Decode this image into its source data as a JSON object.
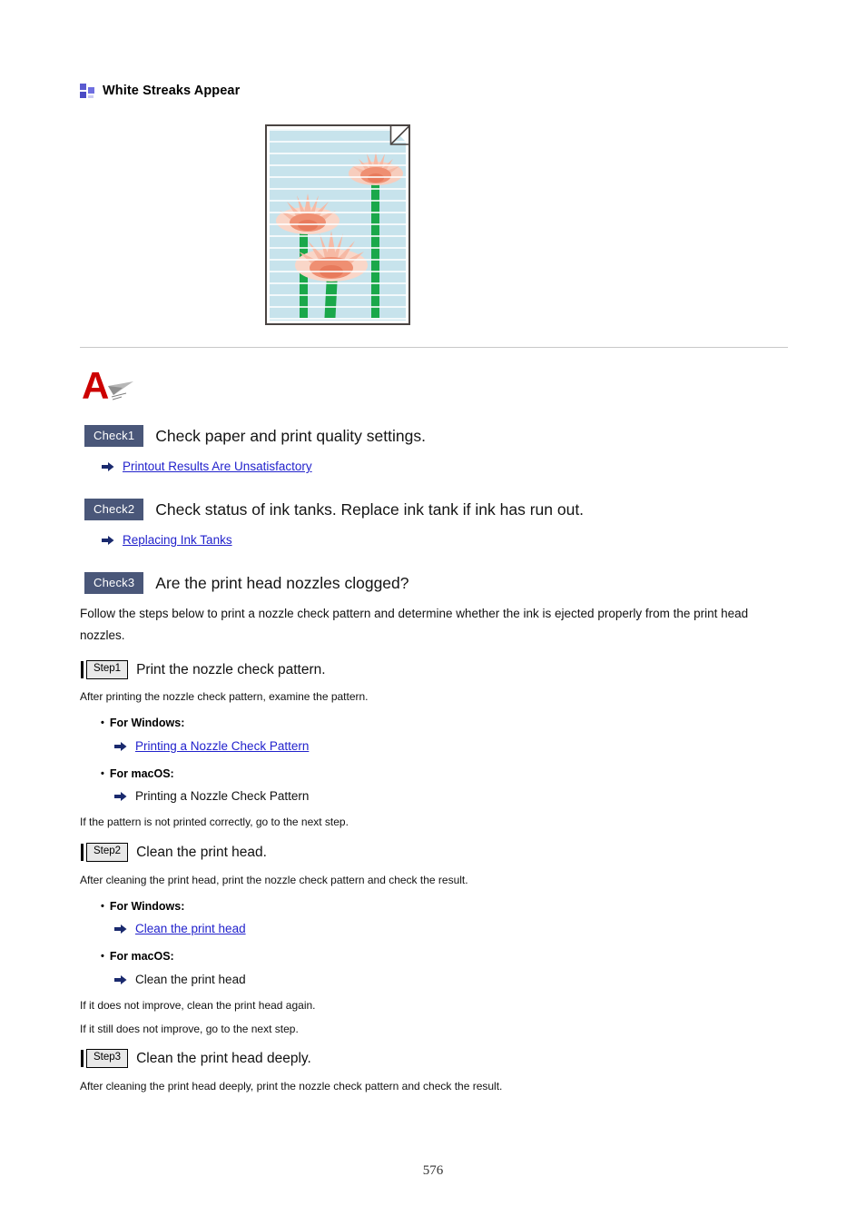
{
  "heading": {
    "icon": "blocks-icon",
    "text": "White Streaks Appear"
  },
  "figure": {
    "name": "printed-sample-with-white-streaks",
    "alt": "Printed photo of pink lotus flowers on a light blue background showing horizontal white streaks",
    "paper_border_color": "#4a4442",
    "background_color": "#c7e3ec",
    "streak_color": "#ffffff",
    "flower_color": "#f2a08c",
    "stem_color": "#1aa84a"
  },
  "answer_icon": {
    "letter": "A",
    "letter_color": "#cc0000",
    "pen_color": "#9a9a9a"
  },
  "checks": [
    {
      "badge": "Check1",
      "title": "Check paper and print quality settings.",
      "links": [
        {
          "label": "Printout Results Are Unsatisfactory",
          "is_link": true
        }
      ]
    },
    {
      "badge": "Check2",
      "title": "Check status of ink tanks. Replace ink tank if ink has run out.",
      "links": [
        {
          "label": "Replacing Ink Tanks",
          "is_link": true
        }
      ]
    },
    {
      "badge": "Check3",
      "title": "Are the print head nozzles clogged?",
      "links": []
    }
  ],
  "intro_paragraph": "Follow the steps below to print a nozzle check pattern and determine whether the ink is ejected properly from the print head nozzles.",
  "steps": [
    {
      "badge": "Step1",
      "title": "Print the nozzle check pattern.",
      "note": "After printing the nozzle check pattern, examine the pattern.",
      "windows_label": "For Windows:",
      "windows_link": "Printing a Nozzle Check Pattern",
      "macos_label": "For macOS:",
      "macos_link": "Printing a Nozzle Check Pattern",
      "after": [
        "If the pattern is not printed correctly, go to the next step."
      ]
    },
    {
      "badge": "Step2",
      "title": "Clean the print head.",
      "note": "After cleaning the print head, print the nozzle check pattern and check the result.",
      "windows_label": "For Windows:",
      "windows_link": "Clean the print head",
      "macos_label": "For macOS:",
      "macos_link": "Clean the print head",
      "after": [
        "If it does not improve, clean the print head again.",
        "If it still does not improve, go to the next step."
      ]
    },
    {
      "badge": "Step3",
      "title": "Clean the print head deeply.",
      "note": "After cleaning the print head deeply, print the nozzle check pattern and check the result.",
      "windows_label": "",
      "windows_link": "",
      "macos_label": "",
      "macos_link": "",
      "after": []
    }
  ],
  "colors": {
    "check_badge_bg": "#4a5779",
    "link": "#2222cc",
    "arrow": "#1a2a6e",
    "divider": "#c8c8c8"
  },
  "page_number": "576"
}
